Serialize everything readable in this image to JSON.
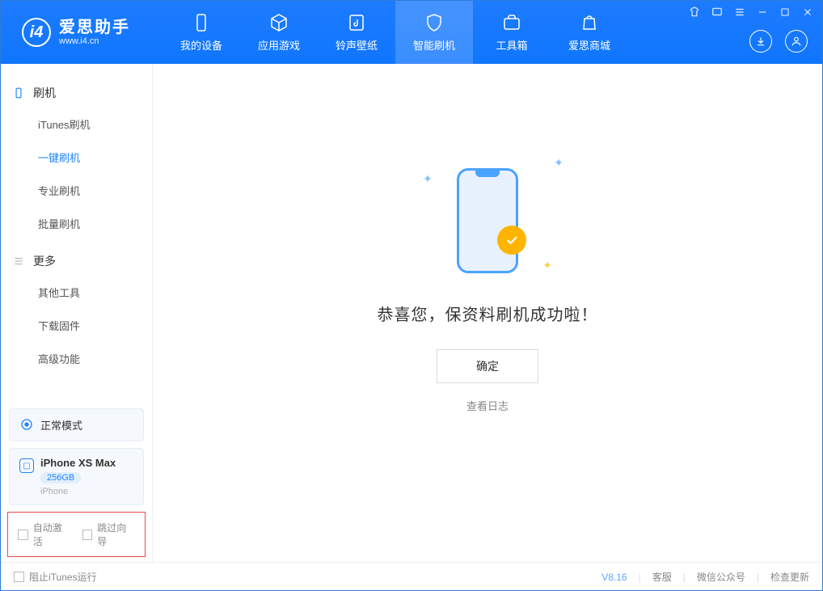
{
  "app": {
    "title": "爱思助手",
    "url": "www.i4.cn"
  },
  "nav": {
    "tabs": [
      {
        "label": "我的设备"
      },
      {
        "label": "应用游戏"
      },
      {
        "label": "铃声壁纸"
      },
      {
        "label": "智能刷机"
      },
      {
        "label": "工具箱"
      },
      {
        "label": "爱思商城"
      }
    ]
  },
  "sidebar": {
    "group1": {
      "title": "刷机",
      "items": [
        {
          "label": "iTunes刷机"
        },
        {
          "label": "一键刷机"
        },
        {
          "label": "专业刷机"
        },
        {
          "label": "批量刷机"
        }
      ]
    },
    "group2": {
      "title": "更多",
      "items": [
        {
          "label": "其他工具"
        },
        {
          "label": "下载固件"
        },
        {
          "label": "高级功能"
        }
      ]
    },
    "mode": "正常模式",
    "device": {
      "name": "iPhone XS Max",
      "storage": "256GB",
      "type": "iPhone"
    },
    "check1": "自动激活",
    "check2": "跳过向导"
  },
  "main": {
    "success_title": "恭喜您，保资料刷机成功啦！",
    "ok_button": "确定",
    "view_log": "查看日志"
  },
  "footer": {
    "block_itunes": "阻止iTunes运行",
    "version": "V8.16",
    "link1": "客服",
    "link2": "微信公众号",
    "link3": "检查更新"
  }
}
